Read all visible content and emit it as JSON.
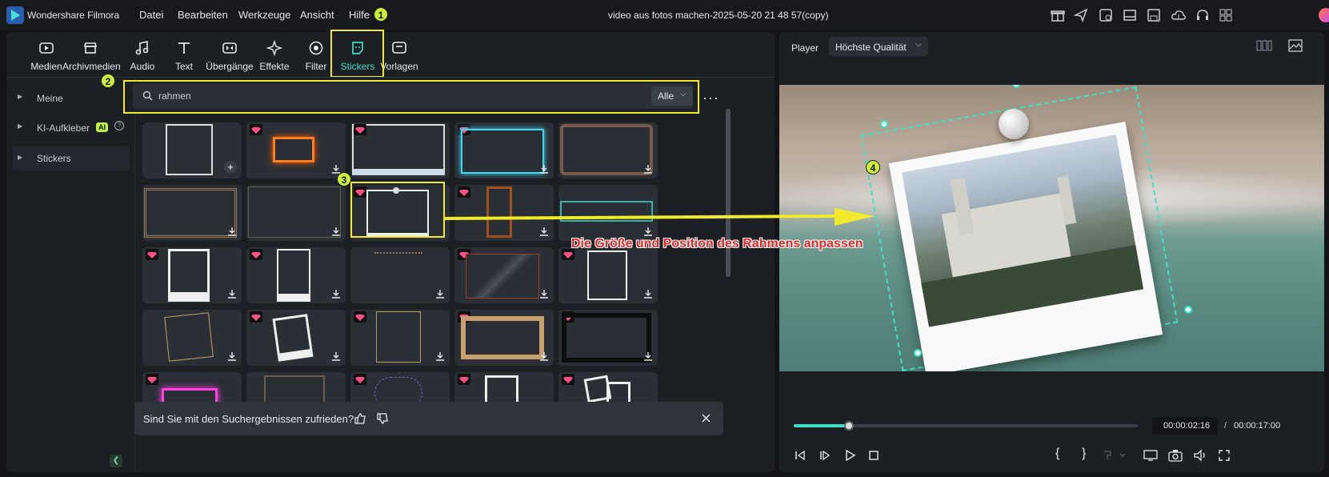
{
  "app": {
    "name": "Wondershare Filmora",
    "project_title": "video aus fotos machen-2025-05-20 21 48 57(copy)"
  },
  "menu": [
    "Datei",
    "Bearbeiten",
    "Werkzeuge",
    "Ansicht",
    "Hilfe"
  ],
  "toolbar": {
    "tabs": [
      "Medien",
      "Archivmedien",
      "Audio",
      "Text",
      "Übergänge",
      "Effekte",
      "Filter",
      "Stickers",
      "Vorlagen"
    ],
    "active": "Stickers"
  },
  "sidebar": {
    "items": [
      {
        "label": "Meine"
      },
      {
        "label": "KI-Aufkleber",
        "badge": "AI"
      },
      {
        "label": "Stickers"
      }
    ]
  },
  "search": {
    "value": "rahmen",
    "filter": "Alle"
  },
  "feedback": {
    "question": "Sind Sie mit den Suchergebnissen zufrieden?"
  },
  "annotations": {
    "badges": [
      "1",
      "2",
      "3",
      "4"
    ],
    "caption": "Die Größe und Position des Rahmens anpassen"
  },
  "player": {
    "label": "Player",
    "quality": "Höchste Qualität",
    "current_time": "00:00:02:16",
    "separator": "/",
    "total_time": "00:00:17:00",
    "progress_fraction": 0.16
  },
  "colors": {
    "accent": "#3fe0c5",
    "highlight": "#f0ea2a",
    "caption_red": "#e8231f",
    "premium_gem": "#ff4f8b"
  }
}
